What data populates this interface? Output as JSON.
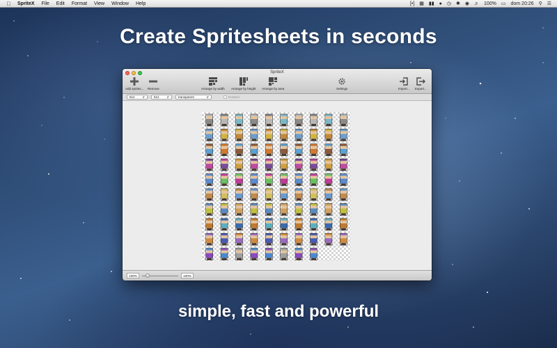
{
  "menubar": {
    "app_name": "SpriteX",
    "items": [
      "File",
      "Edit",
      "Format",
      "View",
      "Window",
      "Help"
    ],
    "battery": "100%",
    "clock": "dom 20:26"
  },
  "headline": "Create Spritesheets in seconds",
  "tagline": "simple, fast and powerful",
  "window": {
    "title": "SpriteX",
    "toolbar": {
      "add_label": "Add sprites...",
      "remove_label": "Remove",
      "arrange_width_label": "Arrange by width",
      "arrange_height_label": "Arrange by height",
      "arrange_area_label": "Arrange by area",
      "settings_label": "Settings",
      "import_label": "Import...",
      "export_label": "Export..."
    },
    "options": {
      "width_value": "512",
      "height_value": "512",
      "background_value": "transparent",
      "rotated_label": "Rotated"
    },
    "zoom": {
      "min_label": "100%",
      "max_label": "100%",
      "level": 0.1
    },
    "sprites": {
      "columns": 10,
      "rows": 10,
      "count": 98
    }
  }
}
